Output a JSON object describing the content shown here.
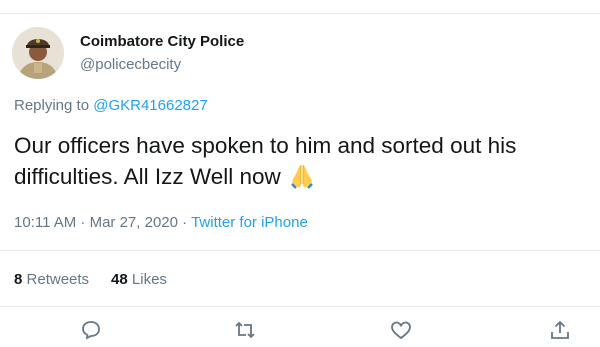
{
  "tweet": {
    "author_name": "Coimbatore City Police",
    "author_handle": "@policecbecity",
    "replying_prefix": "Replying to",
    "replying_to": "@GKR41662827",
    "text": "Our officers have spoken to him and sorted out his difficulties. All Izz Well now",
    "emoji_icon": "folded-hands-icon",
    "timestamp": "10:11 AM · Mar 27, 2020",
    "separator": "·",
    "source": "Twitter for iPhone",
    "retweets_count": "8",
    "retweets_label": "Retweets",
    "likes_count": "48",
    "likes_label": "Likes"
  },
  "actions": [
    {
      "name": "reply",
      "icon": "speech-bubble-icon"
    },
    {
      "name": "retweet",
      "icon": "retweet-arrows-icon"
    },
    {
      "name": "like",
      "icon": "heart-icon"
    },
    {
      "name": "share",
      "icon": "upload-arrow-icon"
    }
  ],
  "colors": {
    "text": "#14171a",
    "secondary": "#657786",
    "link": "#1da1f2",
    "border": "#e6ecf0"
  }
}
